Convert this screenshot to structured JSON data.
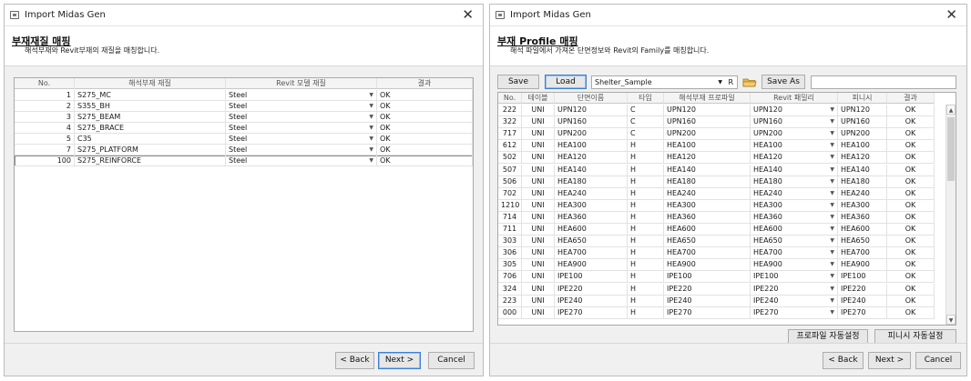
{
  "left": {
    "title": "Import Midas Gen",
    "header_title": "부재재질 매핑",
    "header_desc": "해석부재와 Revit부재의 재질을 매칭합니다.",
    "columns": [
      "No.",
      "해석부재 재질",
      "Revit 모델 재질",
      "결과"
    ],
    "rows": [
      {
        "no": "1",
        "mat": "S275_MC",
        "revit": "Steel",
        "result": "OK"
      },
      {
        "no": "2",
        "mat": "S355_BH",
        "revit": "Steel",
        "result": "OK"
      },
      {
        "no": "3",
        "mat": "S275_BEAM",
        "revit": "Steel",
        "result": "OK"
      },
      {
        "no": "4",
        "mat": "S275_BRACE",
        "revit": "Steel",
        "result": "OK"
      },
      {
        "no": "5",
        "mat": "C35",
        "revit": "Steel",
        "result": "OK"
      },
      {
        "no": "7",
        "mat": "S275_PLATFORM",
        "revit": "Steel",
        "result": "OK"
      },
      {
        "no": "100",
        "mat": "S275_REINFORCE",
        "revit": "Steel",
        "result": "OK"
      }
    ],
    "back": "< Back",
    "next": "Next >",
    "cancel": "Cancel"
  },
  "right": {
    "title": "Import Midas Gen",
    "header_title": "부재 Profile 매핑",
    "header_desc": "해석 파일에서 가져온 단면정보와 Revit의 Family를 매칭합니다.",
    "toolbar": {
      "save": "Save",
      "load": "Load",
      "preset": "Shelter_Sample",
      "preset_suffix": "R",
      "save_as": "Save As",
      "name_value": ""
    },
    "columns": [
      "No.",
      "테이블",
      "단면이름",
      "타입",
      "해석부재 프로파일",
      "Revit 패밀리",
      "피니시",
      "결과"
    ],
    "rows": [
      {
        "no": "222",
        "table": "UNI",
        "name": "UPN120",
        "type": "C",
        "profile": "UPN120",
        "family": "UPN120",
        "finish": "UPN120",
        "result": "OK"
      },
      {
        "no": "322",
        "table": "UNI",
        "name": "UPN160",
        "type": "C",
        "profile": "UPN160",
        "family": "UPN160",
        "finish": "UPN160",
        "result": "OK"
      },
      {
        "no": "717",
        "table": "UNI",
        "name": "UPN200",
        "type": "C",
        "profile": "UPN200",
        "family": "UPN200",
        "finish": "UPN200",
        "result": "OK"
      },
      {
        "no": "612",
        "table": "UNI",
        "name": "HEA100",
        "type": "H",
        "profile": "HEA100",
        "family": "HEA100",
        "finish": "HEA100",
        "result": "OK"
      },
      {
        "no": "502",
        "table": "UNI",
        "name": "HEA120",
        "type": "H",
        "profile": "HEA120",
        "family": "HEA120",
        "finish": "HEA120",
        "result": "OK"
      },
      {
        "no": "507",
        "table": "UNI",
        "name": "HEA140",
        "type": "H",
        "profile": "HEA140",
        "family": "HEA140",
        "finish": "HEA140",
        "result": "OK"
      },
      {
        "no": "506",
        "table": "UNI",
        "name": "HEA180",
        "type": "H",
        "profile": "HEA180",
        "family": "HEA180",
        "finish": "HEA180",
        "result": "OK"
      },
      {
        "no": "702",
        "table": "UNI",
        "name": "HEA240",
        "type": "H",
        "profile": "HEA240",
        "family": "HEA240",
        "finish": "HEA240",
        "result": "OK"
      },
      {
        "no": "1210",
        "table": "UNI",
        "name": "HEA300",
        "type": "H",
        "profile": "HEA300",
        "family": "HEA300",
        "finish": "HEA300",
        "result": "OK"
      },
      {
        "no": "714",
        "table": "UNI",
        "name": "HEA360",
        "type": "H",
        "profile": "HEA360",
        "family": "HEA360",
        "finish": "HEA360",
        "result": "OK"
      },
      {
        "no": "711",
        "table": "UNI",
        "name": "HEA600",
        "type": "H",
        "profile": "HEA600",
        "family": "HEA600",
        "finish": "HEA600",
        "result": "OK"
      },
      {
        "no": "303",
        "table": "UNI",
        "name": "HEA650",
        "type": "H",
        "profile": "HEA650",
        "family": "HEA650",
        "finish": "HEA650",
        "result": "OK"
      },
      {
        "no": "306",
        "table": "UNI",
        "name": "HEA700",
        "type": "H",
        "profile": "HEA700",
        "family": "HEA700",
        "finish": "HEA700",
        "result": "OK"
      },
      {
        "no": "305",
        "table": "UNI",
        "name": "HEA900",
        "type": "H",
        "profile": "HEA900",
        "family": "HEA900",
        "finish": "HEA900",
        "result": "OK"
      },
      {
        "no": "706",
        "table": "UNI",
        "name": "IPE100",
        "type": "H",
        "profile": "IPE100",
        "family": "IPE100",
        "finish": "IPE100",
        "result": "OK"
      },
      {
        "no": "324",
        "table": "UNI",
        "name": "IPE220",
        "type": "H",
        "profile": "IPE220",
        "family": "IPE220",
        "finish": "IPE220",
        "result": "OK"
      },
      {
        "no": "223",
        "table": "UNI",
        "name": "IPE240",
        "type": "H",
        "profile": "IPE240",
        "family": "IPE240",
        "finish": "IPE240",
        "result": "OK"
      },
      {
        "no": "000",
        "table": "UNI",
        "name": "IPE270",
        "type": "H",
        "profile": "IPE270",
        "family": "IPE270",
        "finish": "IPE270",
        "result": "OK"
      }
    ],
    "auto_profile": "프로파일 자동설정",
    "auto_finish": "피니시 자동설정",
    "back": "< Back",
    "next": "Next >",
    "cancel": "Cancel"
  }
}
